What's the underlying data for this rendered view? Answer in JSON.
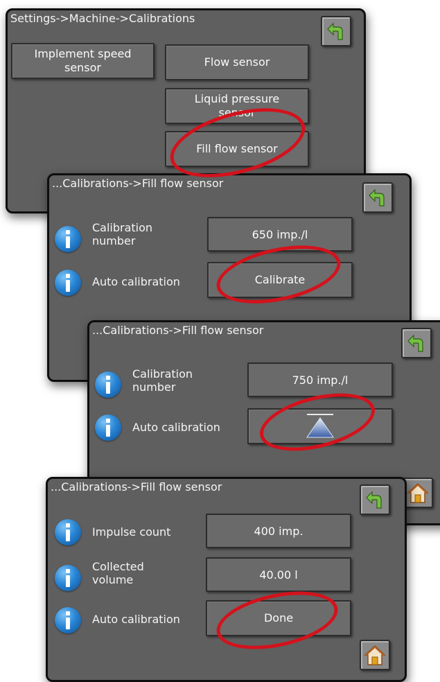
{
  "colors": {
    "panel_bg": "#5f5f5f",
    "button_bg": "#6c6c6c",
    "highlight_ellipse": "#d4121c",
    "back_arrow": "#76c043",
    "info_icon": "#2a87d6"
  },
  "screen1": {
    "title": "Settings->Machine->Calibrations",
    "implement_speed_sensor": "Implement speed sensor",
    "flow_sensor": "Flow sensor",
    "liquid_pressure_sensor": "Liquid pressure sensor",
    "fill_flow_sensor": "Fill flow sensor"
  },
  "screen2": {
    "title": "...Calibrations->Fill flow sensor",
    "calibration_number_label": "Calibration number",
    "calibration_number_value": "650 imp./l",
    "auto_calibration_label": "Auto calibration",
    "calibrate_button": "Calibrate"
  },
  "screen3": {
    "title": "...Calibrations->Fill flow sensor",
    "calibration_number_label": "Calibration number",
    "calibration_number_value": "750 imp./l",
    "auto_calibration_label": "Auto calibration"
  },
  "screen4": {
    "title": "...Calibrations->Fill flow sensor",
    "impulse_count_label": "Impulse count",
    "impulse_count_value": "400 imp.",
    "collected_volume_label": "Collected volume",
    "collected_volume_value": "40.00 l",
    "auto_calibration_label": "Auto calibration",
    "done_button": "Done"
  },
  "icons": {
    "back": "back-arrow-icon",
    "home": "home-icon",
    "info": "info-icon",
    "hourglass": "hourglass-icon"
  }
}
